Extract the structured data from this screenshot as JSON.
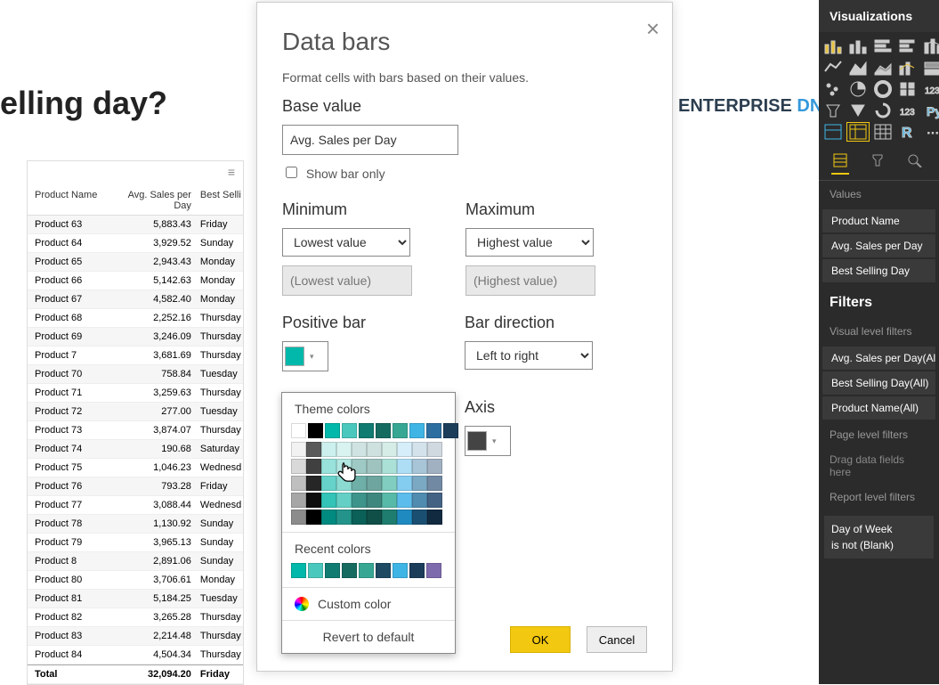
{
  "bg": {
    "heading": "elling day?",
    "logo_left": "ENTERPRISE",
    "logo_right": " DNA"
  },
  "table": {
    "headers": [
      "Product Name",
      "Avg. Sales per Day",
      "Best Selli"
    ],
    "rows": [
      {
        "name": "Product 63",
        "avg": "5,883.43",
        "day": "Friday"
      },
      {
        "name": "Product 64",
        "avg": "3,929.52",
        "day": "Sunday"
      },
      {
        "name": "Product 65",
        "avg": "2,943.43",
        "day": "Monday"
      },
      {
        "name": "Product 66",
        "avg": "5,142.63",
        "day": "Monday"
      },
      {
        "name": "Product 67",
        "avg": "4,582.40",
        "day": "Monday"
      },
      {
        "name": "Product 68",
        "avg": "2,252.16",
        "day": "Thursday"
      },
      {
        "name": "Product 69",
        "avg": "3,246.09",
        "day": "Thursday"
      },
      {
        "name": "Product 7",
        "avg": "3,681.69",
        "day": "Thursday"
      },
      {
        "name": "Product 70",
        "avg": "758.84",
        "day": "Tuesday"
      },
      {
        "name": "Product 71",
        "avg": "3,259.63",
        "day": "Thursday"
      },
      {
        "name": "Product 72",
        "avg": "277.00",
        "day": "Tuesday"
      },
      {
        "name": "Product 73",
        "avg": "3,874.07",
        "day": "Thursday"
      },
      {
        "name": "Product 74",
        "avg": "190.68",
        "day": "Saturday"
      },
      {
        "name": "Product 75",
        "avg": "1,046.23",
        "day": "Wednesd"
      },
      {
        "name": "Product 76",
        "avg": "793.28",
        "day": "Friday"
      },
      {
        "name": "Product 77",
        "avg": "3,088.44",
        "day": "Wednesd"
      },
      {
        "name": "Product 78",
        "avg": "1,130.92",
        "day": "Sunday"
      },
      {
        "name": "Product 79",
        "avg": "3,965.13",
        "day": "Sunday"
      },
      {
        "name": "Product 8",
        "avg": "2,891.06",
        "day": "Sunday"
      },
      {
        "name": "Product 80",
        "avg": "3,706.61",
        "day": "Monday"
      },
      {
        "name": "Product 81",
        "avg": "5,184.25",
        "day": "Tuesday"
      },
      {
        "name": "Product 82",
        "avg": "3,265.28",
        "day": "Thursday"
      },
      {
        "name": "Product 83",
        "avg": "2,214.48",
        "day": "Thursday"
      },
      {
        "name": "Product 84",
        "avg": "4,504.34",
        "day": "Thursday"
      }
    ],
    "total": {
      "label": "Total",
      "avg": "32,094.20",
      "day": "Friday"
    }
  },
  "dialog": {
    "title": "Data bars",
    "desc": "Format cells with bars based on their values.",
    "base_label": "Base value",
    "base_value": "Avg. Sales per Day",
    "show_bar_only": "Show bar only",
    "min_label": "Minimum",
    "min_select": "Lowest value",
    "min_placeholder": "(Lowest value)",
    "max_label": "Maximum",
    "max_select": "Highest value",
    "max_placeholder": "(Highest value)",
    "positive_label": "Positive bar",
    "direction_label": "Bar direction",
    "direction_value": "Left to right",
    "axis_label": "Axis",
    "ok": "OK",
    "cancel": "Cancel",
    "selected_color": "#01b8aa",
    "axis_color": "#444"
  },
  "picker": {
    "theme_label": "Theme colors",
    "theme_row": [
      "#ffffff",
      "#000000",
      "#01b8aa",
      "#4bc8bd",
      "#0f7b71",
      "#166b61",
      "#37a794",
      "#3eb5e5",
      "#2c6ea0",
      "#1c3d5a"
    ],
    "shade_cols": [
      [
        "#f2f2f2",
        "#d9d9d9",
        "#bfbfbf",
        "#a6a6a6",
        "#8c8c8c"
      ],
      [
        "#595959",
        "#404040",
        "#262626",
        "#0d0d0d",
        "#000000"
      ],
      [
        "#ccf0ed",
        "#99e1db",
        "#66d2c9",
        "#33c3b7",
        "#018a80"
      ],
      [
        "#d8f3f0",
        "#b2e7e2",
        "#8bdbd3",
        "#64cfc5",
        "#24948a"
      ],
      [
        "#cfe4e2",
        "#9ec9c4",
        "#6eafa7",
        "#3d948a",
        "#0b6058"
      ],
      [
        "#cfe1df",
        "#9fc3bf",
        "#6ea59f",
        "#3e877f",
        "#104f48"
      ],
      [
        "#d5ece7",
        "#abe0d7",
        "#81cdc0",
        "#57baa8",
        "#1f7d6f"
      ],
      [
        "#d6eefa",
        "#aedef5",
        "#85cdf0",
        "#5cbceb",
        "#1f8ac0"
      ],
      [
        "#d3e2eb",
        "#a7c5d7",
        "#7ba8c3",
        "#508bb0",
        "#1b4f72"
      ],
      [
        "#d0d8e0",
        "#a1b1c1",
        "#7289a3",
        "#436284",
        "#122a40"
      ]
    ],
    "recent_label": "Recent colors",
    "recent_row": [
      "#01b8aa",
      "#4bc8bd",
      "#0f7b71",
      "#166b61",
      "#37a794",
      "#1e4a63",
      "#3eb5e5",
      "#1c3d5a",
      "#7e6bad"
    ],
    "custom": "Custom color",
    "revert": "Revert to default"
  },
  "viz": {
    "title": "Visualizations",
    "values_label": "Values",
    "fields": [
      "Product Name",
      "Avg. Sales per Day",
      "Best Selling Day"
    ],
    "filters_label": "Filters",
    "visual_filters_label": "Visual level filters",
    "visual_filters": [
      "Avg. Sales per Day(Al",
      "Best Selling Day(All)",
      "Product Name(All)"
    ],
    "page_filters_label": "Page level filters",
    "page_hint": "Drag data fields here",
    "report_filters_label": "Report level filters",
    "report_filter_line1": "Day of Week",
    "report_filter_line2": "is not (Blank)"
  }
}
